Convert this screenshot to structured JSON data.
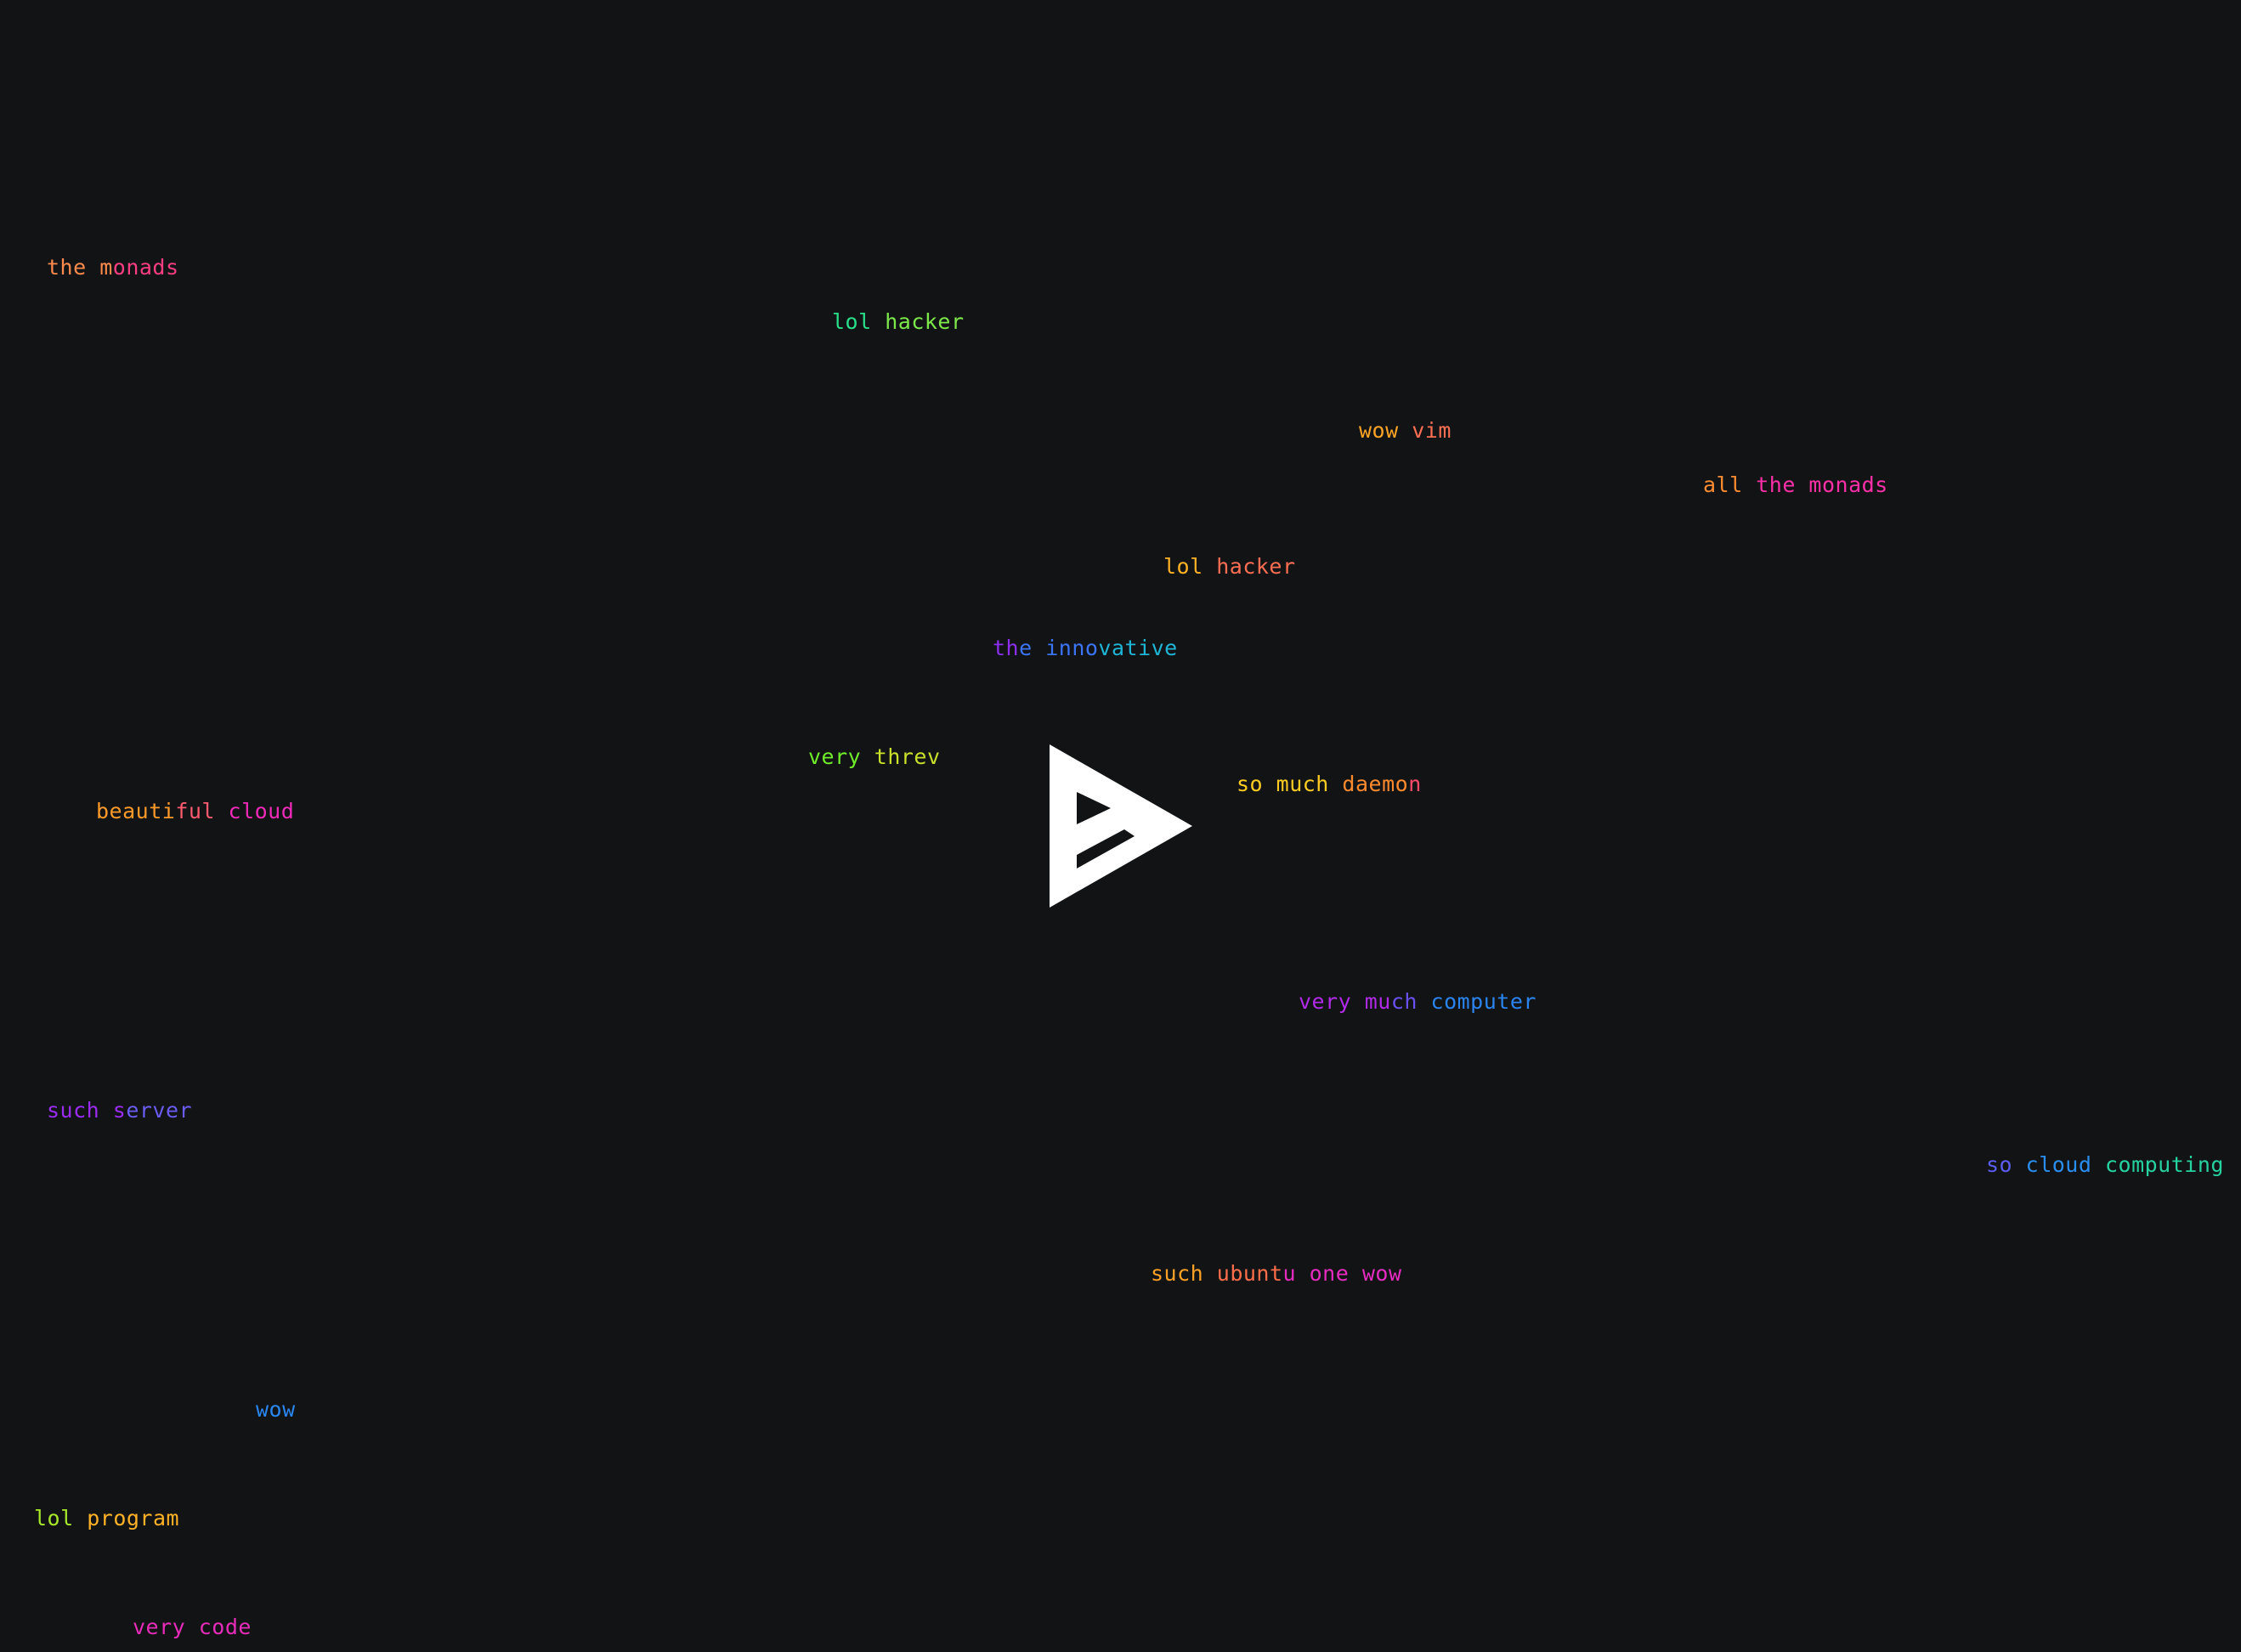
{
  "background": "#121315",
  "logo": {
    "icon": "asciinema-logo-icon",
    "fill": "#ffffff",
    "cutout": "#121315"
  },
  "phrases": [
    {
      "name": "phrase-the-monads",
      "text": "the monads",
      "segments": [
        {
          "text": "the m",
          "color": "#ff8a4d"
        },
        {
          "text": "onads",
          "color": "#ff3e82"
        }
      ]
    },
    {
      "name": "phrase-lol-hacker-1",
      "text": "lol hacker",
      "segments": [
        {
          "text": "lol ",
          "color": "#29e08a"
        },
        {
          "text": "hacker",
          "color": "#7de84a"
        }
      ]
    },
    {
      "name": "phrase-wow-vim",
      "text": "wow vim",
      "segments": [
        {
          "text": "wow ",
          "color": "#ffa326"
        },
        {
          "text": "vim",
          "color": "#ff6f52"
        }
      ]
    },
    {
      "name": "phrase-all-the-monads",
      "text": "all the monads",
      "segments": [
        {
          "text": "all ",
          "color": "#ff8c30"
        },
        {
          "text": "the monads",
          "color": "#ff2fa8"
        }
      ]
    },
    {
      "name": "phrase-lol-hacker-2",
      "text": "lol hacker",
      "segments": [
        {
          "text": "lol ",
          "color": "#ffb226"
        },
        {
          "text": "hacker",
          "color": "#ff6e52"
        }
      ]
    },
    {
      "name": "phrase-the-innovative",
      "text": "the innovative",
      "segments": [
        {
          "text": "th",
          "color": "#8c2ff0"
        },
        {
          "text": "e inno",
          "color": "#3b74f5"
        },
        {
          "text": "vative",
          "color": "#1fb5d6"
        }
      ]
    },
    {
      "name": "phrase-very-threv",
      "text": "very threv",
      "segments": [
        {
          "text": "very ",
          "color": "#6fec2a"
        },
        {
          "text": "threv",
          "color": "#c8e02a"
        }
      ]
    },
    {
      "name": "phrase-so-much-daemon",
      "text": "so much daemon",
      "segments": [
        {
          "text": "so much ",
          "color": "#ffcc22"
        },
        {
          "text": "daemo",
          "color": "#ff8a2e"
        },
        {
          "text": "n",
          "color": "#ff4a6a"
        }
      ]
    },
    {
      "name": "phrase-beautiful-cloud",
      "text": "beautiful cloud",
      "segments": [
        {
          "text": "beauti",
          "color": "#ff9a2a"
        },
        {
          "text": "ful ",
          "color": "#ff5a70"
        },
        {
          "text": "cloud",
          "color": "#ef2ab8"
        }
      ]
    },
    {
      "name": "phrase-very-much-computer",
      "text": "very much computer",
      "segments": [
        {
          "text": "very mu",
          "color": "#b02ae8"
        },
        {
          "text": "ch ",
          "color": "#6a50f0"
        },
        {
          "text": "computer",
          "color": "#2b84ee"
        }
      ]
    },
    {
      "name": "phrase-such-server",
      "text": "such server",
      "segments": [
        {
          "text": "such s",
          "color": "#9a2cf0"
        },
        {
          "text": "erver",
          "color": "#6a5cf2"
        }
      ]
    },
    {
      "name": "phrase-so-cloud-computing",
      "text": "so cloud computing",
      "segments": [
        {
          "text": "so ",
          "color": "#5a5ef2"
        },
        {
          "text": "cloud ",
          "color": "#2a8ef0"
        },
        {
          "text": "computing",
          "color": "#25d2a0"
        }
      ]
    },
    {
      "name": "phrase-such-ubuntu-one-wow",
      "text": "such ubuntu one wow",
      "segments": [
        {
          "text": "such ",
          "color": "#ffa026"
        },
        {
          "text": "ubunt",
          "color": "#ff6e4a"
        },
        {
          "text": "u one wow",
          "color": "#e62cc0"
        }
      ]
    },
    {
      "name": "phrase-wow",
      "text": "wow",
      "segments": [
        {
          "text": "wow",
          "color": "#2a86f0"
        }
      ]
    },
    {
      "name": "phrase-lol-program",
      "text": "lol program",
      "segments": [
        {
          "text": "lol ",
          "color": "#a8e82a"
        },
        {
          "text": "program",
          "color": "#ffb226"
        }
      ]
    },
    {
      "name": "phrase-very-code",
      "text": "very code",
      "segments": [
        {
          "text": "very code",
          "color": "#e62cb8"
        }
      ]
    }
  ]
}
